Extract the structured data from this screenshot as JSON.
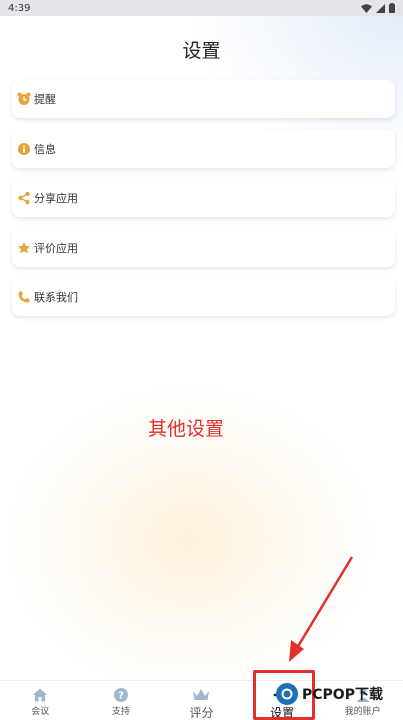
{
  "status_bar": {
    "time": "4:39"
  },
  "header": {
    "title": "设置"
  },
  "menu": {
    "items": [
      {
        "label": "提醒",
        "icon": "alarm-clock-icon",
        "color": "#e6a43c"
      },
      {
        "label": "信息",
        "icon": "info-icon",
        "color": "#e6a43c"
      },
      {
        "label": "分享应用",
        "icon": "share-icon",
        "color": "#e6a43c"
      },
      {
        "label": "评价应用",
        "icon": "star-icon",
        "color": "#e6a43c"
      },
      {
        "label": "联系我们",
        "icon": "phone-icon",
        "color": "#e6a43c"
      }
    ]
  },
  "annotation": {
    "text": "其他设置",
    "color": "#e2302a"
  },
  "tabs": [
    {
      "label": "会议",
      "icon": "home-icon"
    },
    {
      "label": "支持",
      "icon": "help-icon"
    },
    {
      "label": "评分",
      "icon": "crown-icon"
    },
    {
      "label": "设置",
      "icon": "gear-icon",
      "active": true
    },
    {
      "label": "我的账户",
      "icon": "account-icon"
    }
  ],
  "watermark": {
    "text": "PCPOP下载"
  }
}
